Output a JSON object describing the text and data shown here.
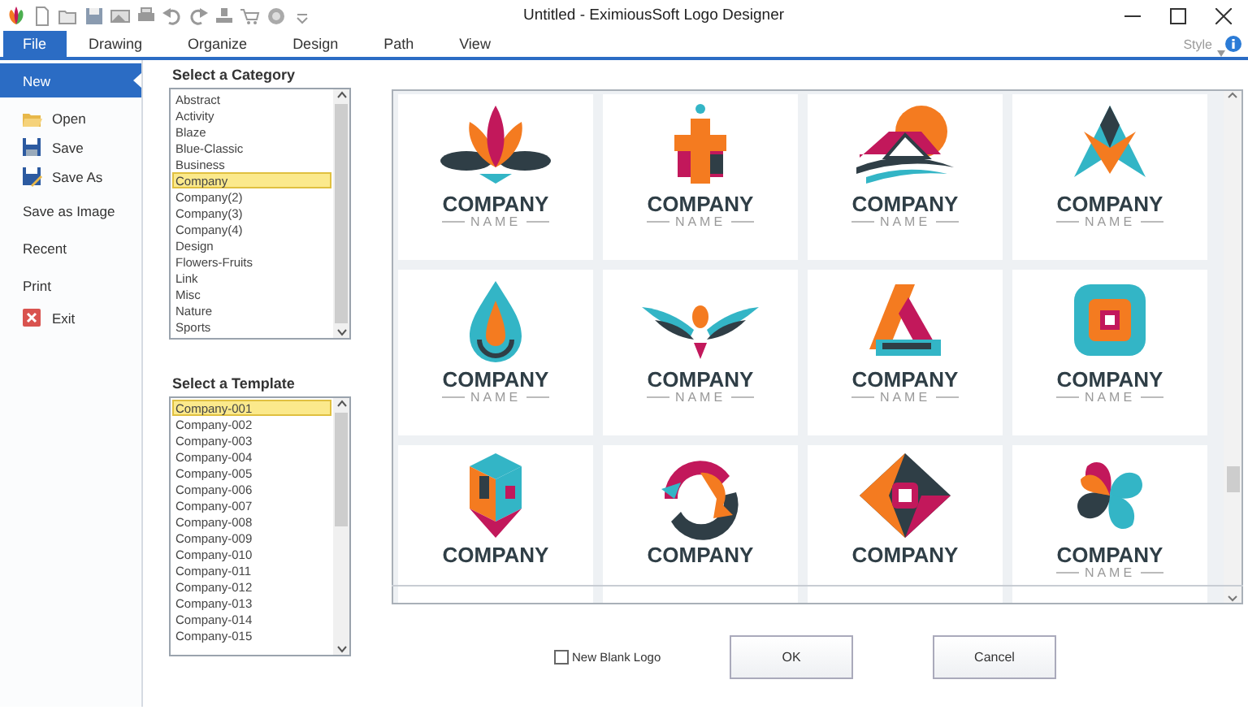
{
  "window": {
    "title": "Untitled - EximiousSoft Logo Designer"
  },
  "tabs": [
    {
      "label": "File",
      "selected": true
    },
    {
      "label": "Drawing",
      "selected": false
    },
    {
      "label": "Organize",
      "selected": false
    },
    {
      "label": "Design",
      "selected": false
    },
    {
      "label": "Path",
      "selected": false
    },
    {
      "label": "View",
      "selected": false
    }
  ],
  "style_menu": {
    "label": "Style"
  },
  "backstage": [
    {
      "label": "New",
      "selected": true
    },
    {
      "label": "Open",
      "selected": false
    },
    {
      "label": "Save",
      "selected": false
    },
    {
      "label": "Save As",
      "selected": false
    },
    {
      "label": "Save as Image",
      "selected": false
    },
    {
      "label": "Recent",
      "selected": false
    },
    {
      "label": "Print",
      "selected": false
    },
    {
      "label": "Exit",
      "selected": false
    }
  ],
  "category": {
    "heading": "Select a Category",
    "items": [
      {
        "label": "Abstract",
        "selected": false
      },
      {
        "label": "Activity",
        "selected": false
      },
      {
        "label": "Blaze",
        "selected": false
      },
      {
        "label": "Blue-Classic",
        "selected": false
      },
      {
        "label": "Business",
        "selected": false
      },
      {
        "label": "Company",
        "selected": true
      },
      {
        "label": "Company(2)",
        "selected": false
      },
      {
        "label": "Company(3)",
        "selected": false
      },
      {
        "label": "Company(4)",
        "selected": false
      },
      {
        "label": "Design",
        "selected": false
      },
      {
        "label": "Flowers-Fruits",
        "selected": false
      },
      {
        "label": "Link",
        "selected": false
      },
      {
        "label": "Misc",
        "selected": false
      },
      {
        "label": "Nature",
        "selected": false
      },
      {
        "label": "Sports",
        "selected": false
      }
    ]
  },
  "template": {
    "heading": "Select a Template",
    "items": [
      {
        "label": "Company-001",
        "selected": true
      },
      {
        "label": "Company-002",
        "selected": false
      },
      {
        "label": "Company-003",
        "selected": false
      },
      {
        "label": "Company-004",
        "selected": false
      },
      {
        "label": "Company-005",
        "selected": false
      },
      {
        "label": "Company-006",
        "selected": false
      },
      {
        "label": "Company-007",
        "selected": false
      },
      {
        "label": "Company-008",
        "selected": false
      },
      {
        "label": "Company-009",
        "selected": false
      },
      {
        "label": "Company-010",
        "selected": false
      },
      {
        "label": "Company-011",
        "selected": false
      },
      {
        "label": "Company-012",
        "selected": false
      },
      {
        "label": "Company-013",
        "selected": false
      },
      {
        "label": "Company-014",
        "selected": false
      },
      {
        "label": "Company-015",
        "selected": false
      }
    ]
  },
  "logos": [
    {
      "company": "COMPANY",
      "name": "NAME"
    },
    {
      "company": "COMPANY",
      "name": "NAME"
    },
    {
      "company": "COMPANY",
      "name": "NAME"
    },
    {
      "company": "COMPANY",
      "name": "NAME"
    },
    {
      "company": "COMPANY",
      "name": "NAME"
    },
    {
      "company": "COMPANY",
      "name": "NAME"
    },
    {
      "company": "COMPANY",
      "name": "NAME"
    },
    {
      "company": "COMPANY",
      "name": "NAME"
    },
    {
      "company": "COMPANY"
    },
    {
      "company": "COMPANY"
    },
    {
      "company": "COMPANY"
    },
    {
      "company": "COMPANY",
      "name": "NAME"
    }
  ],
  "new_blank_logo": {
    "label": "New Blank Logo",
    "checked": false
  },
  "buttons": [
    {
      "label": "OK"
    },
    {
      "label": "Cancel"
    }
  ]
}
